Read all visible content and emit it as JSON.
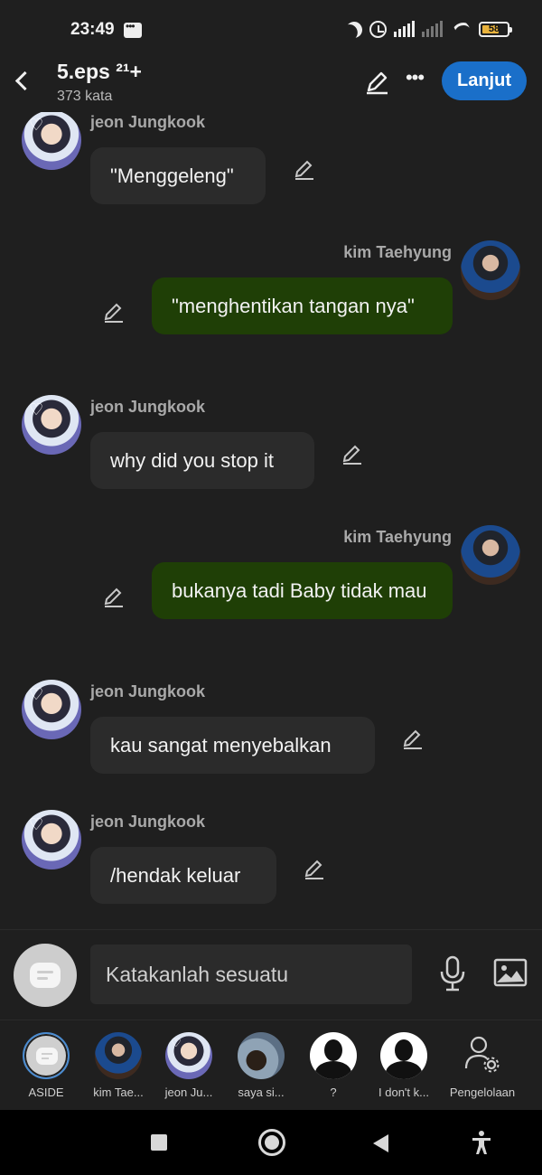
{
  "status_bar": {
    "time": "23:49",
    "battery": "58"
  },
  "header": {
    "title": "5.eps ²¹+",
    "word_count": "373 kata",
    "next_label": "Lanjut"
  },
  "messages": [
    {
      "sender": "jeon Jungkook",
      "side": "left",
      "text": "\"Menggeleng\""
    },
    {
      "sender": "kim Taehyung",
      "side": "right",
      "text": "\"menghentikan tangan nya\""
    },
    {
      "sender": "jeon Jungkook",
      "side": "left",
      "text": "why did you stop it"
    },
    {
      "sender": "kim Taehyung",
      "side": "right",
      "text": "bukanya tadi Baby tidak mau"
    },
    {
      "sender": "jeon Jungkook",
      "side": "left",
      "text": "kau sangat menyebalkan"
    },
    {
      "sender": "jeon Jungkook",
      "side": "left",
      "text": "/hendak keluar"
    }
  ],
  "composer": {
    "placeholder": "Katakanlah sesuatu"
  },
  "cast": [
    {
      "label": "ASIDE",
      "icon": "aside-icon"
    },
    {
      "label": "kim Tae...",
      "icon": "avatar-taehyung"
    },
    {
      "label": "jeon Ju...",
      "icon": "avatar-jungkook"
    },
    {
      "label": "saya si...",
      "icon": "avatar-dog"
    },
    {
      "label": "?",
      "icon": "avatar-silhouette"
    },
    {
      "label": "I don't k...",
      "icon": "avatar-silhouette"
    },
    {
      "label": "Pengelolaan",
      "icon": "manage-icon"
    }
  ],
  "colors": {
    "background": "#1f1f1f",
    "bubble_left": "#2b2b2b",
    "bubble_right": "#1f3f06",
    "accent": "#1a6fc9"
  }
}
